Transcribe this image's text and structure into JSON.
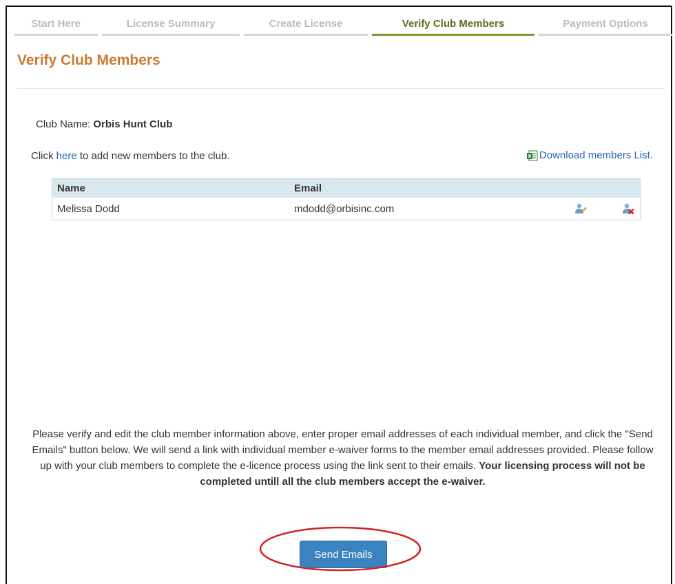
{
  "tabs": [
    {
      "label": "Start Here",
      "active": false
    },
    {
      "label": "License Summary",
      "active": false
    },
    {
      "label": "Create License",
      "active": false
    },
    {
      "label": "Verify Club Members",
      "active": true
    },
    {
      "label": "Payment Options",
      "active": false
    }
  ],
  "page": {
    "title": "Verify Club Members"
  },
  "club": {
    "name_label": "Club Name:",
    "name_value": "Orbis Hunt Club"
  },
  "add_members": {
    "prefix": "Click",
    "link": "here",
    "suffix": "to add new members to the club."
  },
  "download": {
    "label": "Download members List.",
    "icon": "excel-icon"
  },
  "members_table": {
    "columns": [
      "Name",
      "Email"
    ],
    "rows": [
      {
        "name": "Melissa Dodd",
        "email": "mdodd@orbisinc.com"
      }
    ],
    "icons": {
      "edit": "edit-user-icon",
      "delete": "delete-user-icon"
    }
  },
  "notice": {
    "text": "Please verify and edit the club member information above, enter proper email addresses of each individual member, and click the \"Send Emails\" button below. We will send a link with individual member e-waiver forms to the member email addresses provided. Please follow up with your club members to complete the e-licence process using the link sent to their emails.",
    "bold": "Your licensing process will not be completed untill all the club members accept the e-waiver."
  },
  "send_button": {
    "label": "Send Emails"
  },
  "colors": {
    "title": "#cc7a33",
    "active_tab": "#7a9a2a",
    "button": "#3a82c0",
    "highlight_circle": "#d42020"
  }
}
